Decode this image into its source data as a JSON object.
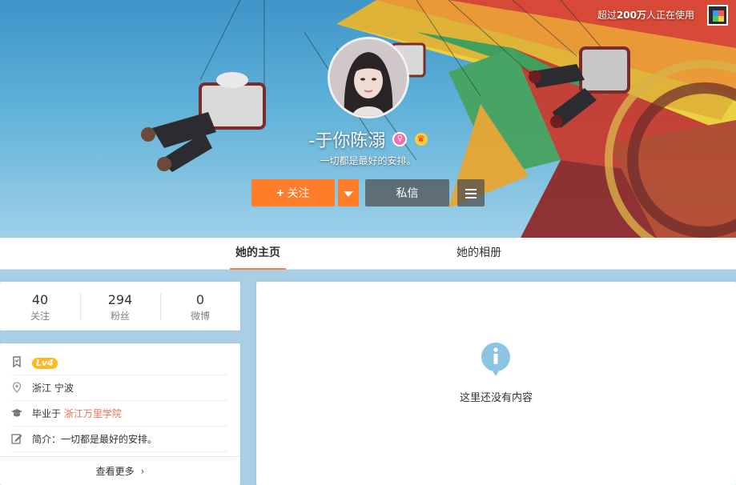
{
  "promo": {
    "prefix": "超过",
    "count": "200万",
    "suffix": "人正在使用"
  },
  "profile": {
    "name": "-于你陈溺",
    "bio": "一切都是最好的安排。"
  },
  "actions": {
    "follow_plus": "+",
    "follow_label": "关注",
    "message_label": "私信"
  },
  "tabs": [
    {
      "label": "她的主页",
      "active": true
    },
    {
      "label": "她的相册",
      "active": false
    }
  ],
  "stats": [
    {
      "value": "40",
      "label": "关注"
    },
    {
      "value": "294",
      "label": "粉丝"
    },
    {
      "value": "0",
      "label": "微博"
    }
  ],
  "info": {
    "level": "Lv4",
    "location": "浙江 宁波",
    "school_prefix": "毕业于",
    "school_name": "浙江万里学院",
    "intro": "简介：一切都是最好的安排。",
    "more_label": "查看更多",
    "more_chevron": "›"
  },
  "main": {
    "empty_text": "这里还没有内容"
  },
  "colors": {
    "accent": "#ff7d29",
    "tab_underline": "#fa7d3c",
    "link": "#eb7350",
    "level_badge": "#ffb820",
    "info_icon": "#8dc3e3",
    "page_bg": "#a9cfe6"
  },
  "icons": {
    "badge_female": "female-badge-icon",
    "badge_crown": "vip-crown-icon",
    "promo": "app-icon",
    "dropdown": "caret-down-icon",
    "menu": "menu-icon",
    "level": "bookmark-icon",
    "location": "location-pin-icon",
    "school": "graduation-cap-icon",
    "intro": "edit-icon",
    "empty": "info-icon"
  }
}
